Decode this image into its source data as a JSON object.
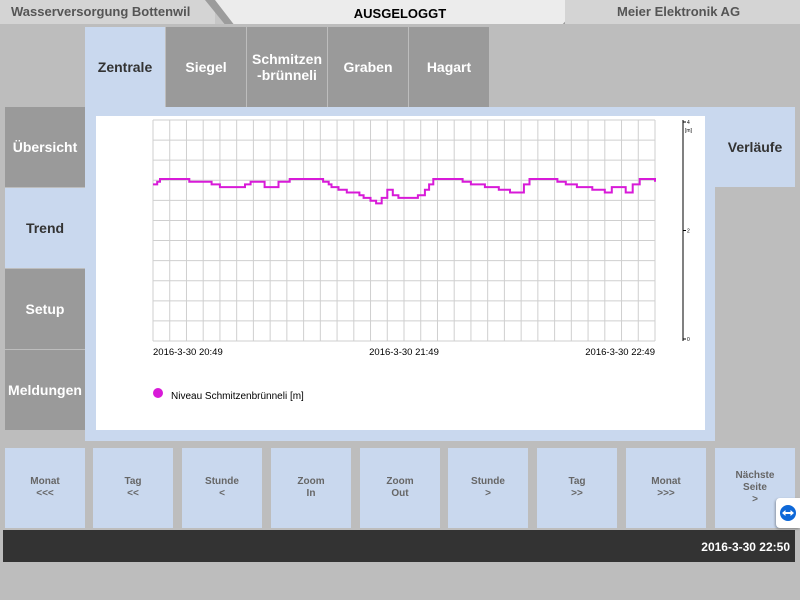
{
  "header": {
    "left": "Wasserversorgung Bottenwil",
    "center": "AUSGELOGGT",
    "right": "Meier Elektronik AG"
  },
  "tabs": [
    {
      "label": "Zentrale",
      "active": true
    },
    {
      "label": "Siegel",
      "active": false
    },
    {
      "label": "Schmitzen-brünneli",
      "active": false
    },
    {
      "label": "Graben",
      "active": false
    },
    {
      "label": "Hagart",
      "active": false
    }
  ],
  "nav": [
    {
      "label": "Übersicht",
      "active": false
    },
    {
      "label": "Trend",
      "active": true
    },
    {
      "label": "Setup",
      "active": false
    },
    {
      "label": "Meldungen",
      "active": false
    }
  ],
  "side": {
    "verlaeufe": "Verläufe"
  },
  "chart_data": {
    "type": "line",
    "x_tick_labels": [
      "2016-3-30 20:49",
      "2016-3-30 21:49",
      "2016-3-30 22:49"
    ],
    "y_axis": {
      "unit_label": "[m]",
      "tick_labels": [
        "4",
        "2",
        "0"
      ],
      "ylim": [
        0,
        4
      ]
    },
    "grid": true,
    "legend": {
      "label": "Niveau Schmitzenbrünneli [m]",
      "placement": "bottom-left",
      "color": "#d81ad8"
    },
    "series": [
      {
        "name": "Niveau Schmitzenbrünneli [m]",
        "color": "#d81ad8",
        "minutes": [
          0,
          3,
          5,
          10,
          20,
          26,
          36,
          42,
          48,
          50,
          55,
          62,
          66,
          70,
          72,
          74,
          80,
          85,
          90,
          98,
          103,
          108,
          110,
          114,
          118,
          122,
          126,
          128,
          133,
          139,
          143,
          148,
          151,
          156,
          160,
          164,
          168,
          172,
          176,
          180,
          186,
          190,
          195,
          198,
          201,
          206,
          212,
          218,
          222,
          228,
          233,
          238,
          240,
          244,
          248,
          252,
          256,
          262,
          266,
          270,
          274,
          280,
          286,
          290,
          294,
          296,
          300,
          304,
          308,
          310,
          315,
          319,
          324,
          329,
          334,
          339,
          344,
          349,
          354,
          360,
          362
        ],
        "values": [
          2.85,
          2.9,
          2.95,
          2.95,
          2.95,
          2.9,
          2.9,
          2.85,
          2.8,
          2.8,
          2.8,
          2.8,
          2.85,
          2.9,
          2.9,
          2.9,
          2.8,
          2.8,
          2.9,
          2.95,
          2.95,
          2.95,
          2.95,
          2.95,
          2.95,
          2.9,
          2.85,
          2.8,
          2.75,
          2.7,
          2.7,
          2.65,
          2.6,
          2.55,
          2.5,
          2.6,
          2.75,
          2.65,
          2.6,
          2.6,
          2.6,
          2.65,
          2.75,
          2.85,
          2.95,
          2.95,
          2.95,
          2.95,
          2.9,
          2.85,
          2.85,
          2.8,
          2.8,
          2.8,
          2.75,
          2.75,
          2.7,
          2.7,
          2.85,
          2.95,
          2.95,
          2.95,
          2.95,
          2.9,
          2.9,
          2.85,
          2.85,
          2.8,
          2.8,
          2.8,
          2.75,
          2.75,
          2.7,
          2.8,
          2.8,
          2.7,
          2.85,
          2.95,
          2.95,
          2.9,
          2.9
        ]
      }
    ]
  },
  "buttons": [
    {
      "line1": "Monat",
      "line2": "<<<"
    },
    {
      "line1": "Tag",
      "line2": "<<"
    },
    {
      "line1": "Stunde",
      "line2": "<"
    },
    {
      "line1": "Zoom",
      "line2": "In"
    },
    {
      "line1": "Zoom",
      "line2": "Out"
    },
    {
      "line1": "Stunde",
      "line2": ">"
    },
    {
      "line1": "Tag",
      "line2": ">>"
    },
    {
      "line1": "Monat",
      "line2": ">>>"
    },
    {
      "line1": "Nächste",
      "line2": "Seite",
      "line3": ">"
    }
  ],
  "status": {
    "datetime": "2016-3-30 22:50"
  },
  "colors": {
    "accent": "#c9d8ee",
    "inactive": "#9a9a9a",
    "line": "#d81ad8",
    "statusbar": "#333333"
  }
}
